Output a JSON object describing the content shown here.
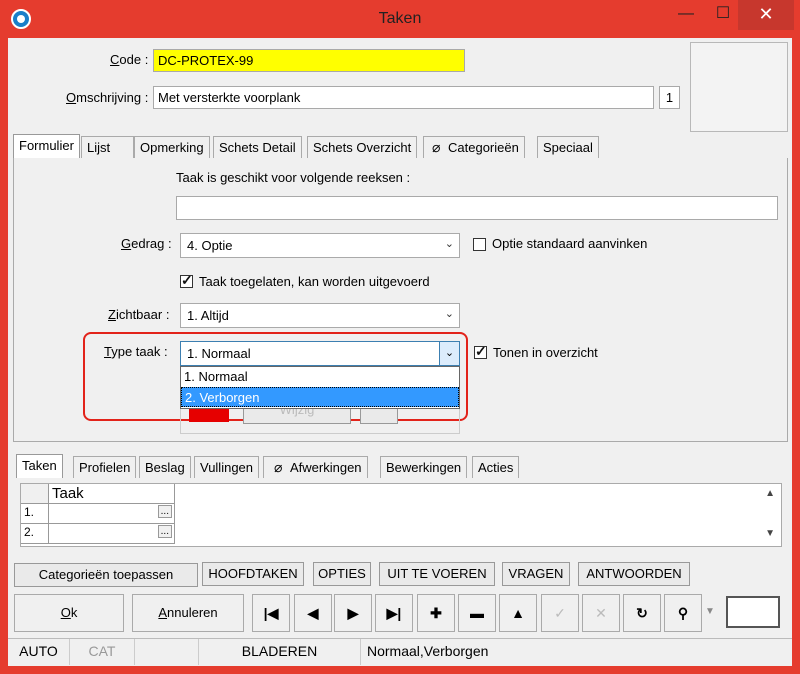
{
  "window": {
    "title": "Taken",
    "minimize_icon": "—",
    "maximize_icon": "☐",
    "close_icon": "✕"
  },
  "header": {
    "code_label_u": "C",
    "code_label_rest": "ode :",
    "code_value": "DC-PROTEX-99",
    "description_label_u": "O",
    "description_label_rest": "mschrijving :",
    "description_value": "Met versterkte voorplank",
    "description_index": "1"
  },
  "top_tabs": [
    "Formulier",
    "Lijst",
    "Opmerking",
    "Schets Detail",
    "Schets Overzicht",
    "Categorieën",
    "Speciaal"
  ],
  "form": {
    "reeksen_label": "Taak is geschikt voor volgende reeksen :",
    "reeksen_value": "",
    "gedrag_label_u": "G",
    "gedrag_label_rest": "edrag :",
    "gedrag_value": "4.  Optie",
    "optie_standaard_label": "Optie standaard aanvinken",
    "taak_toegelaten_label": "Taak toegelaten, kan worden uitgevoerd",
    "zichtbaar_label_u": "Z",
    "zichtbaar_label_rest": "ichtbaar :",
    "zichtbaar_value": "1.  Altijd",
    "type_taak_label_u": "T",
    "type_taak_label_rest": "ype taak :",
    "type_taak_value": "1.  Normaal",
    "type_taak_options": [
      "1.  Normaal",
      "2.  Verborgen"
    ],
    "tonen_label": "Tonen in overzicht",
    "hidden_button_label": "Wijzig",
    "accent_color": "#e60000"
  },
  "bottom_tabs": [
    "Taken",
    "Profielen",
    "Beslag",
    "Vullingen",
    "Afwerkingen",
    "Bewerkingen",
    "Acties"
  ],
  "grid": {
    "header": "Taak",
    "rows": [
      "1.",
      "2."
    ],
    "ellipsis": "..."
  },
  "action_buttons": [
    "Categorieën toepassen",
    "HOOFDTAKEN",
    "OPTIES",
    "UIT TE VOEREN",
    "VRAGEN",
    "ANTWOORDEN"
  ],
  "footer": {
    "ok_u": "O",
    "ok_rest": "k",
    "cancel_u": "A",
    "cancel_rest": "nnuleren",
    "nav_icons": [
      "|◀",
      "◀",
      "▶",
      "▶|",
      "✚",
      "▬",
      "▲",
      "✓",
      "✕",
      "↻",
      "⚲"
    ]
  },
  "status": {
    "mode1": "AUTO",
    "mode2": "CAT",
    "state": "BLADEREN",
    "info": "Normaal,Verborgen"
  }
}
